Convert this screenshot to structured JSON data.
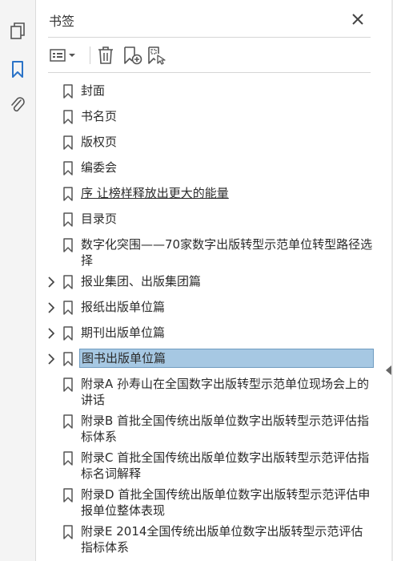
{
  "panel": {
    "title": "书签",
    "close_icon": "close-icon"
  },
  "rail": {
    "icons": [
      "pages-icon",
      "bookmark-icon",
      "attachment-icon"
    ],
    "active_color": "#2b73c7"
  },
  "toolbar": {
    "icons": [
      "options-menu-icon",
      "delete-icon",
      "new-bookmark-icon",
      "bookmark-from-selection-icon"
    ]
  },
  "bookmarks": [
    {
      "label": "封面",
      "expandable": false
    },
    {
      "label": "书名页",
      "expandable": false
    },
    {
      "label": "版权页",
      "expandable": false
    },
    {
      "label": "编委会",
      "expandable": false
    },
    {
      "label": "序  让榜样释放出更大的能量",
      "expandable": false,
      "underlined": true
    },
    {
      "label": "目录页",
      "expandable": false
    },
    {
      "label": "数字化突围——70家数字出版转型示范单位转型路径选择",
      "expandable": false
    },
    {
      "label": "报业集团、出版集团篇",
      "expandable": true
    },
    {
      "label": "报纸出版单位篇",
      "expandable": true
    },
    {
      "label": "期刊出版单位篇",
      "expandable": true
    },
    {
      "label": "图书出版单位篇",
      "expandable": true,
      "selected": true
    },
    {
      "label": "附录A  孙寿山在全国数字出版转型示范单位现场会上的讲话",
      "expandable": false
    },
    {
      "label": "附录B  首批全国传统出版单位数字出版转型示范评估指标体系",
      "expandable": false
    },
    {
      "label": "附录C  首批全国传统出版单位数字出版转型示范评估指标名词解释",
      "expandable": false
    },
    {
      "label": "附录D  首批全国传统出版单位数字出版转型示范评估申报单位整体表现",
      "expandable": false
    },
    {
      "label": "附录E  2014全国传统出版单位数字出版转型示范评估指标体系",
      "expandable": false
    }
  ],
  "colors": {
    "selected_bg": "#a6c8e3",
    "selected_border": "#6f9cc1"
  }
}
